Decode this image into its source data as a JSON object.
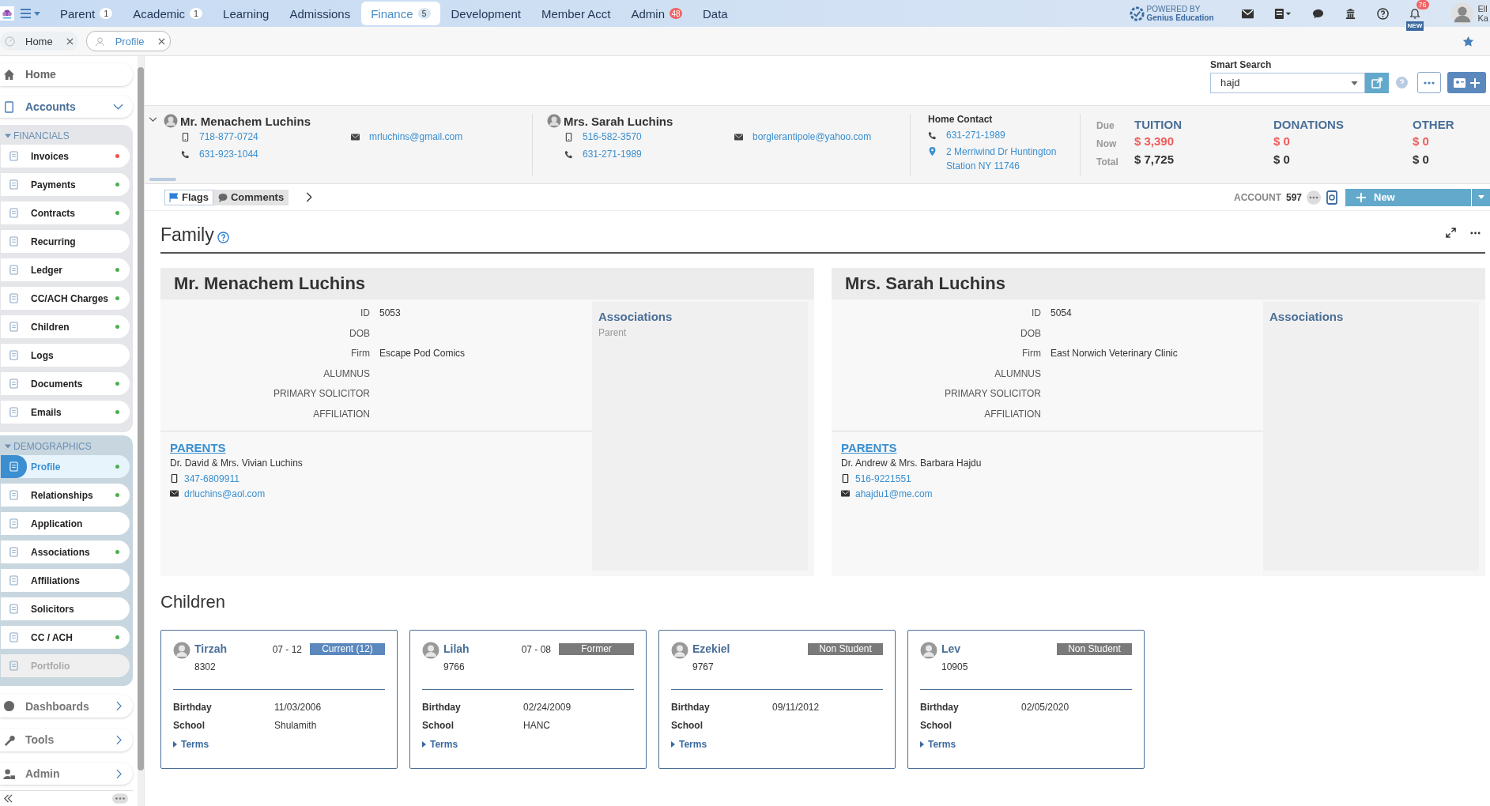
{
  "nav": {
    "items": [
      {
        "label": "Parent",
        "badge": "1",
        "alert": false,
        "selected": false
      },
      {
        "label": "Academic",
        "badge": "1",
        "alert": false,
        "selected": false
      },
      {
        "label": "Learning",
        "selected": false
      },
      {
        "label": "Admissions",
        "selected": false
      },
      {
        "label": "Finance",
        "badge": "5",
        "alert": false,
        "selected": true
      },
      {
        "label": "Development",
        "selected": false
      },
      {
        "label": "Member Acct",
        "selected": false
      },
      {
        "label": "Admin",
        "badge": "48",
        "alert": true,
        "selected": false
      },
      {
        "label": "Data",
        "selected": false
      }
    ],
    "powered_by": "POWERED BY",
    "brand": "Genius Education",
    "notifications": "76",
    "new_tag": "NEW",
    "user": [
      "Ell",
      "Ka"
    ]
  },
  "tabs": [
    {
      "label": "Home",
      "selected": false
    },
    {
      "label": "Profile",
      "selected": true
    }
  ],
  "sidebar": {
    "top": [
      {
        "label": "Home"
      },
      {
        "label": "Accounts",
        "expanded": true
      }
    ],
    "groups": [
      {
        "title": "FINANCIALS",
        "items": [
          {
            "label": "Invoices",
            "color": "#ef5350",
            "selected": false,
            "disabled": false
          },
          {
            "label": "Payments",
            "color": "#4caf50",
            "selected": false,
            "disabled": false
          },
          {
            "label": "Contracts",
            "color": "#4caf50",
            "selected": false,
            "disabled": false
          },
          {
            "label": "Recurring",
            "selected": false,
            "disabled": false
          },
          {
            "label": "Ledger",
            "color": "#4caf50",
            "selected": false,
            "disabled": false
          },
          {
            "label": "CC/ACH Charges",
            "color": "#4caf50",
            "selected": false,
            "disabled": false
          },
          {
            "label": "Children",
            "color": "#4caf50",
            "selected": false,
            "disabled": false
          },
          {
            "label": "Logs",
            "selected": false,
            "disabled": false
          },
          {
            "label": "Documents",
            "color": "#4caf50",
            "selected": false,
            "disabled": false
          },
          {
            "label": "Emails",
            "color": "#4caf50",
            "selected": false,
            "disabled": false
          }
        ]
      },
      {
        "title": "DEMOGRAPHICS",
        "items": [
          {
            "label": "Profile",
            "color": "#4caf50",
            "selected": true,
            "disabled": false
          },
          {
            "label": "Relationships",
            "color": "#4caf50",
            "selected": false,
            "disabled": false
          },
          {
            "label": "Application",
            "selected": false,
            "disabled": false
          },
          {
            "label": "Associations",
            "color": "#4caf50",
            "selected": false,
            "disabled": false
          },
          {
            "label": "Affiliations",
            "selected": false,
            "disabled": false
          },
          {
            "label": "Solicitors",
            "selected": false,
            "disabled": false
          },
          {
            "label": "CC / ACH",
            "color": "#4caf50",
            "selected": false,
            "disabled": false
          },
          {
            "label": "Portfolio",
            "selected": false,
            "disabled": true
          }
        ]
      }
    ],
    "bottom": [
      {
        "label": "Dashboards"
      },
      {
        "label": "Tools"
      },
      {
        "label": "Admin"
      }
    ]
  },
  "smart_search": {
    "label": "Smart Search",
    "value": "hajd"
  },
  "header": {
    "contacts": [
      {
        "name": "Mr. Menachem Luchins",
        "mobile": "718-877-0724",
        "phone": "631-923-1044",
        "email": "mrluchins@gmail.com"
      },
      {
        "name": "Mrs. Sarah Luchins",
        "mobile": "516-582-3570",
        "phone": "631-271-1989",
        "email": "borglerantipole@yahoo.com"
      }
    ],
    "home_contact": {
      "title": "Home Contact",
      "phone": "631-271-1989",
      "address": [
        "2 Merriwind Dr Huntington",
        "Station NY 11746"
      ]
    },
    "row_labels": [
      "Due",
      "Now",
      "Total"
    ],
    "balances": [
      {
        "title": "TUITION",
        "now": "$ 3,390",
        "total": "$ 7,725"
      },
      {
        "title": "DONATIONS",
        "now": "$ 0",
        "total": "$ 0"
      },
      {
        "title": "OTHER",
        "now": "$ 0",
        "total": "$ 0"
      }
    ]
  },
  "toolbar": {
    "tabs": [
      {
        "label": "Flags",
        "selected": true
      },
      {
        "label": "Comments",
        "selected": false
      }
    ],
    "account_label": "ACCOUNT",
    "account_number": "597",
    "new_button": "New"
  },
  "family": {
    "title": "Family",
    "members": [
      {
        "name": "Mr. Menachem Luchins",
        "fields": [
          {
            "label": "ID",
            "value": "5053"
          },
          {
            "label": "DOB"
          },
          {
            "label": "Firm",
            "value": "Escape Pod Comics"
          },
          {
            "label": "ALUMNUS"
          },
          {
            "label": "PRIMARY SOLICITOR"
          },
          {
            "label": "AFFILIATION"
          }
        ],
        "associations_title": "Associations",
        "associations": [
          "Parent"
        ],
        "parents": {
          "title": "PARENTS",
          "names": "Dr. David & Mrs. Vivian Luchins",
          "phone": "347-6809911",
          "email": "drluchins@aol.com"
        }
      },
      {
        "name": "Mrs. Sarah Luchins",
        "fields": [
          {
            "label": "ID",
            "value": "5054"
          },
          {
            "label": "DOB"
          },
          {
            "label": "Firm",
            "value": "East Norwich Veterinary Clinic"
          },
          {
            "label": "ALUMNUS"
          },
          {
            "label": "PRIMARY SOLICITOR"
          },
          {
            "label": "AFFILIATION"
          }
        ],
        "associations_title": "Associations",
        "parents": {
          "title": "PARENTS",
          "names": "Dr. Andrew & Mrs. Barbara Hajdu",
          "phone": "516-9221551",
          "email": "ahajdu1@me.com"
        }
      }
    ]
  },
  "children": {
    "title": "Children",
    "items": [
      {
        "name": "Tirzah",
        "id": "8302",
        "grades": "07 - 12",
        "status": "Current  (12)",
        "kind": "current",
        "birthday_label": "Birthday",
        "birthday": "11/03/2006",
        "school_label": "School",
        "school": "Shulamith",
        "terms": "Terms"
      },
      {
        "name": "Lilah",
        "id": "9766",
        "grades": "07 - 08",
        "status": "Former",
        "kind": "other",
        "birthday_label": "Birthday",
        "birthday": "02/24/2009",
        "school_label": "School",
        "school": "HANC",
        "terms": "Terms"
      },
      {
        "name": "Ezekiel",
        "id": "9767",
        "status": "Non Student",
        "kind": "other",
        "birthday_label": "Birthday",
        "birthday": "09/11/2012",
        "school_label": "School",
        "terms": "Terms"
      },
      {
        "name": "Lev",
        "id": "10905",
        "status": "Non Student",
        "kind": "other",
        "birthday_label": "Birthday",
        "birthday": "02/05/2020",
        "school_label": "School",
        "terms": "Terms"
      }
    ]
  }
}
